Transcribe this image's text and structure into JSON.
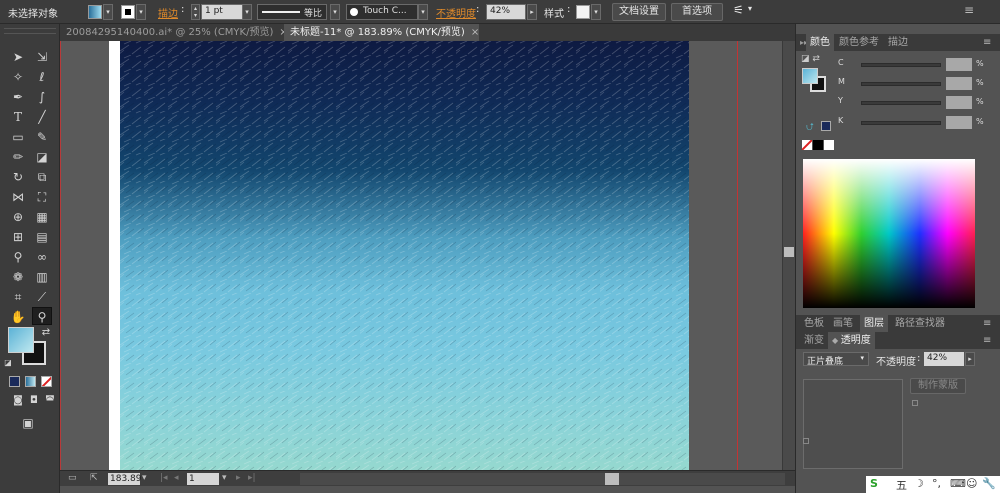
{
  "control_bar": {
    "selection_status": "未选择对象",
    "stroke_label": "描边",
    "stroke_weight": "1 pt",
    "stroke_profile": "等比",
    "brush_name": "Touch C...",
    "opacity_label": "不透明度",
    "opacity_value": "42%",
    "style_label": "样式",
    "doc_setup_button": "文档设置",
    "prefs_button": "首选项",
    "colors": {
      "fill": "#4fa4c8",
      "stroke": "#000000"
    }
  },
  "tabs": [
    {
      "label": "20084295140400.ai* @ 25% (CMYK/预览)",
      "active": false
    },
    {
      "label": "未标题-11* @ 183.89% (CMYK/预览)",
      "active": true
    }
  ],
  "tools": [
    "selection-tool",
    "direct-selection-tool",
    "magic-wand-tool",
    "lasso-tool",
    "pen-tool",
    "curvature-tool",
    "type-tool",
    "line-tool",
    "rectangle-tool",
    "paintbrush-tool",
    "pencil-tool",
    "eraser-tool",
    "rotate-tool",
    "scale-tool",
    "width-tool",
    "free-transform-tool",
    "shape-builder-tool",
    "perspective-grid-tool",
    "mesh-tool",
    "gradient-tool",
    "eyedropper-tool",
    "blend-tool",
    "symbol-sprayer-tool",
    "column-graph-tool",
    "artboard-tool",
    "slice-tool",
    "hand-tool",
    "zoom-tool"
  ],
  "canvas": {
    "gradient_colors": [
      "#0e1a42",
      "#12466e",
      "#6dbfdb",
      "#95d8cf"
    ]
  },
  "status_bar": {
    "zoom": "183.89",
    "artboard_number": "1",
    "tool_label": "缩放"
  },
  "color_panel": {
    "tabs": [
      "颜色",
      "颜色参考",
      "描边"
    ],
    "channels": [
      {
        "key": "C",
        "unit": "%"
      },
      {
        "key": "M",
        "unit": "%"
      },
      {
        "key": "Y",
        "unit": "%"
      },
      {
        "key": "K",
        "unit": "%"
      }
    ]
  },
  "layers_panel": {
    "tabs": [
      "色板",
      "画笔",
      "图层",
      "路径查找器"
    ]
  },
  "transparency_panel": {
    "tabs": [
      "渐变",
      "透明度"
    ],
    "blend_mode": "正片叠底",
    "opacity_label": "不透明度",
    "opacity_value": "42%",
    "make_mask_button": "制作蒙版"
  },
  "taskbar": {
    "ime_label": "五"
  }
}
